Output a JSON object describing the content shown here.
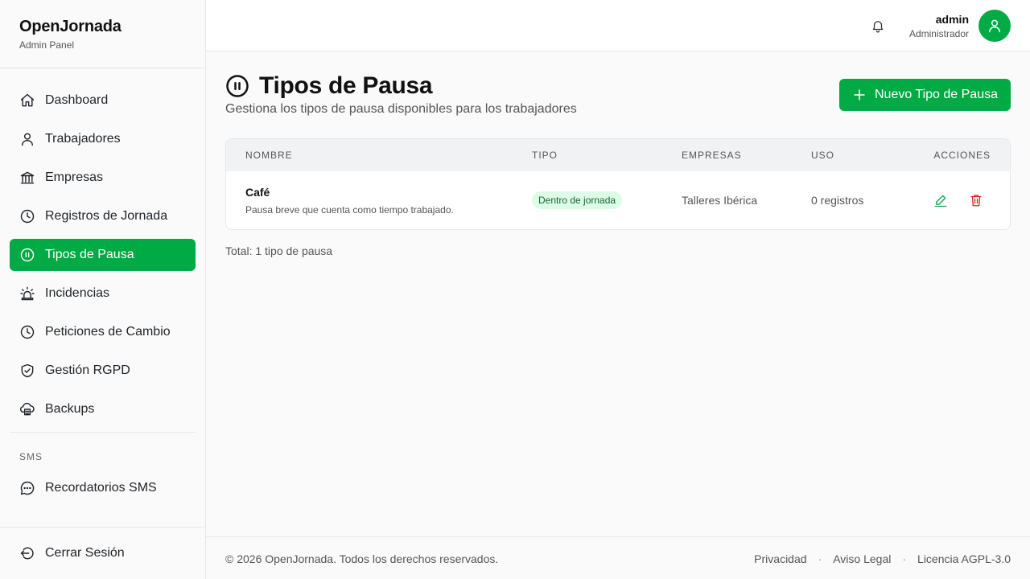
{
  "brand": {
    "title": "OpenJornada",
    "subtitle": "Admin Panel"
  },
  "sidebar": {
    "items": [
      {
        "label": "Dashboard",
        "icon": "home-icon"
      },
      {
        "label": "Trabajadores",
        "icon": "user-icon"
      },
      {
        "label": "Empresas",
        "icon": "bank-icon"
      },
      {
        "label": "Registros de Jornada",
        "icon": "clock-icon"
      },
      {
        "label": "Tipos de Pausa",
        "icon": "pause-circle-icon",
        "active": true
      },
      {
        "label": "Incidencias",
        "icon": "alarm-icon"
      },
      {
        "label": "Peticiones de Cambio",
        "icon": "clock-icon"
      },
      {
        "label": "Gestión RGPD",
        "icon": "shield-check-icon"
      },
      {
        "label": "Backups",
        "icon": "cloud-icon"
      }
    ],
    "section_sms": "SMS",
    "sms_item": {
      "label": "Recordatorios SMS",
      "icon": "chat-bubble-icon"
    },
    "logout": {
      "label": "Cerrar Sesión",
      "icon": "logout-icon"
    }
  },
  "header": {
    "user_name": "admin",
    "user_role": "Administrador"
  },
  "page": {
    "title": "Tipos de Pausa",
    "subtitle": "Gestiona los tipos de pausa disponibles para los trabajadores",
    "new_button": "Nuevo Tipo de Pausa"
  },
  "table": {
    "columns": [
      "NOMBRE",
      "TIPO",
      "EMPRESAS",
      "USO",
      "ACCIONES"
    ],
    "rows": [
      {
        "name": "Café",
        "description": "Pausa breve que cuenta como tiempo trabajado.",
        "type": "Dentro de jornada",
        "company": "Talleres Ibérica",
        "usage": "0 registros"
      }
    ],
    "total": "Total: 1 tipo de pausa"
  },
  "footer": {
    "copyright": "© 2026 OpenJornada. Todos los derechos reservados.",
    "links": [
      "Privacidad",
      "Aviso Legal",
      "Licencia AGPL-3.0"
    ],
    "separator": "·"
  },
  "colors": {
    "accent": "#00aa44",
    "badge_bg": "#dcfce7",
    "badge_text": "#166534",
    "danger": "#dc2626"
  }
}
